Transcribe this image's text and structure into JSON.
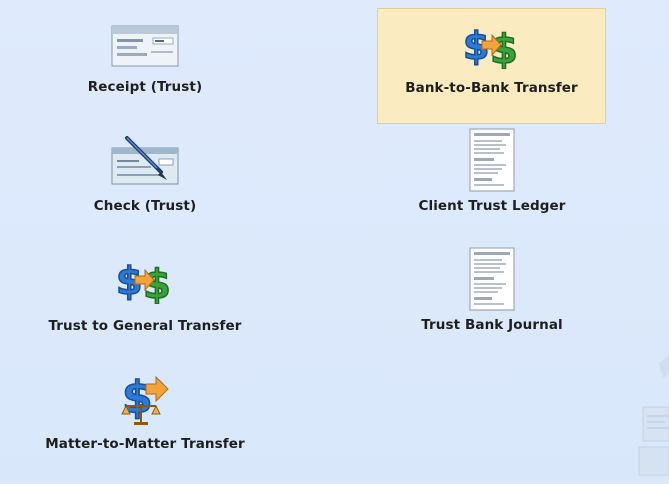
{
  "tiles": {
    "receipt_trust": {
      "label": "Receipt (Trust)",
      "icon": "receipt-icon"
    },
    "bank_to_bank": {
      "label": "Bank-to-Bank Transfer",
      "icon": "money-transfer-icon",
      "selected": true
    },
    "check_trust": {
      "label": "Check (Trust)",
      "icon": "check-pen-icon"
    },
    "client_trust_ledger": {
      "label": "Client Trust Ledger",
      "icon": "report-document-icon"
    },
    "trust_to_general": {
      "label": "Trust to General Transfer",
      "icon": "money-transfer-icon"
    },
    "trust_bank_journal": {
      "label": "Trust Bank Journal",
      "icon": "report-document-icon"
    },
    "matter_to_matter": {
      "label": "Matter-to-Matter Transfer",
      "icon": "money-scale-transfer-icon"
    }
  },
  "colors": {
    "background": "#dbe9fb",
    "selected_tile": "#faebc1",
    "money_green": "#3aa43a",
    "money_blue": "#2d79d6",
    "arrow_orange": "#f2a33a"
  }
}
